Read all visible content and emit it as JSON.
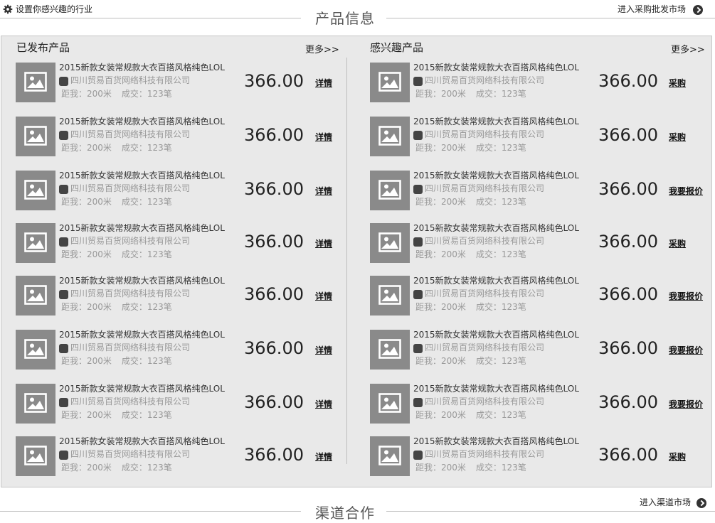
{
  "header": {
    "industry_label": "设置你感兴趣的行业",
    "section_title": "产品信息",
    "market_link": "进入采购批发市场"
  },
  "left": {
    "title": "已发布产品",
    "more": "更多>>",
    "items": [
      {
        "title": "2015新款女装常规款大衣百搭风格纯色LOL",
        "company": "四川贸易百货网络科技有限公司",
        "distance": "距我：200米",
        "deals": "成交：123笔",
        "price": "366.00",
        "action": "详情"
      },
      {
        "title": "2015新款女装常规款大衣百搭风格纯色LOL",
        "company": "四川贸易百货网络科技有限公司",
        "distance": "距我：200米",
        "deals": "成交：123笔",
        "price": "366.00",
        "action": "详情"
      },
      {
        "title": "2015新款女装常规款大衣百搭风格纯色LOL",
        "company": "四川贸易百货网络科技有限公司",
        "distance": "距我：200米",
        "deals": "成交：123笔",
        "price": "366.00",
        "action": "详情"
      },
      {
        "title": "2015新款女装常规款大衣百搭风格纯色LOL",
        "company": "四川贸易百货网络科技有限公司",
        "distance": "距我：200米",
        "deals": "成交：123笔",
        "price": "366.00",
        "action": "详情"
      },
      {
        "title": "2015新款女装常规款大衣百搭风格纯色LOL",
        "company": "四川贸易百货网络科技有限公司",
        "distance": "距我：200米",
        "deals": "成交：123笔",
        "price": "366.00",
        "action": "详情"
      },
      {
        "title": "2015新款女装常规款大衣百搭风格纯色LOL",
        "company": "四川贸易百货网络科技有限公司",
        "distance": "距我：200米",
        "deals": "成交：123笔",
        "price": "366.00",
        "action": "详情"
      },
      {
        "title": "2015新款女装常规款大衣百搭风格纯色LOL",
        "company": "四川贸易百货网络科技有限公司",
        "distance": "距我：200米",
        "deals": "成交：123笔",
        "price": "366.00",
        "action": "详情"
      },
      {
        "title": "2015新款女装常规款大衣百搭风格纯色LOL",
        "company": "四川贸易百货网络科技有限公司",
        "distance": "距我：200米",
        "deals": "成交：123笔",
        "price": "366.00",
        "action": "详情"
      }
    ]
  },
  "right": {
    "title": "感兴趣产品",
    "more": "更多>>",
    "items": [
      {
        "title": "2015新款女装常规款大衣百搭风格纯色LOL",
        "company": "四川贸易百货网络科技有限公司",
        "distance": "距我：200米",
        "deals": "成交：123笔",
        "price": "366.00",
        "action": "采购"
      },
      {
        "title": "2015新款女装常规款大衣百搭风格纯色LOL",
        "company": "四川贸易百货网络科技有限公司",
        "distance": "距我：200米",
        "deals": "成交：123笔",
        "price": "366.00",
        "action": "采购"
      },
      {
        "title": "2015新款女装常规款大衣百搭风格纯色LOL",
        "company": "四川贸易百货网络科技有限公司",
        "distance": "距我：200米",
        "deals": "成交：123笔",
        "price": "366.00",
        "action": "我要报价"
      },
      {
        "title": "2015新款女装常规款大衣百搭风格纯色LOL",
        "company": "四川贸易百货网络科技有限公司",
        "distance": "距我：200米",
        "deals": "成交：123笔",
        "price": "366.00",
        "action": "采购"
      },
      {
        "title": "2015新款女装常规款大衣百搭风格纯色LOL",
        "company": "四川贸易百货网络科技有限公司",
        "distance": "距我：200米",
        "deals": "成交：123笔",
        "price": "366.00",
        "action": "我要报价"
      },
      {
        "title": "2015新款女装常规款大衣百搭风格纯色LOL",
        "company": "四川贸易百货网络科技有限公司",
        "distance": "距我：200米",
        "deals": "成交：123笔",
        "price": "366.00",
        "action": "我要报价"
      },
      {
        "title": "2015新款女装常规款大衣百搭风格纯色LOL",
        "company": "四川贸易百货网络科技有限公司",
        "distance": "距我：200米",
        "deals": "成交：123笔",
        "price": "366.00",
        "action": "我要报价"
      },
      {
        "title": "2015新款女装常规款大衣百搭风格纯色LOL",
        "company": "四川贸易百货网络科技有限公司",
        "distance": "距我：200米",
        "deals": "成交：123笔",
        "price": "366.00",
        "action": "采购"
      }
    ]
  },
  "footer": {
    "section_title": "渠道合作",
    "market_link": "进入渠道市场"
  },
  "icons": {
    "gear": "gear-icon",
    "arrow": "arrow-right-circle-icon",
    "thumbnail": "image-placeholder-icon",
    "company_badge": "company-badge-icon"
  }
}
